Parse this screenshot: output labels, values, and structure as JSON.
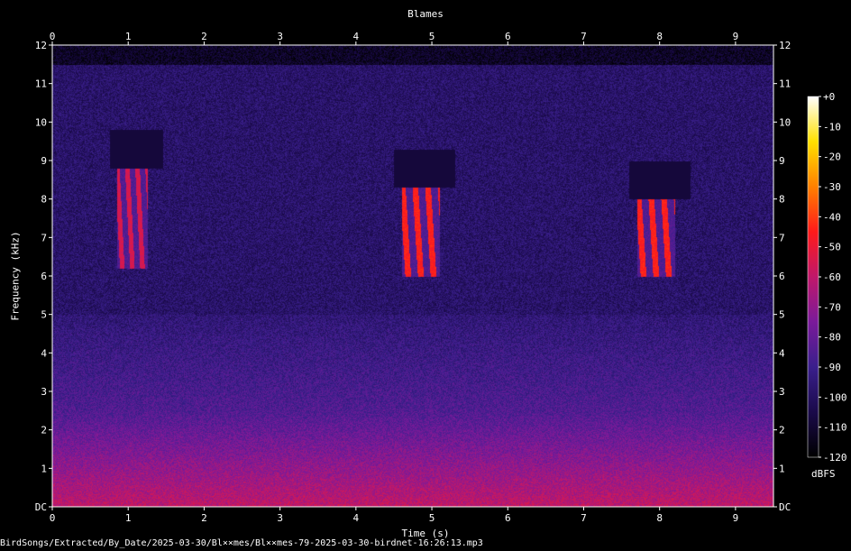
{
  "chart_data": {
    "type": "heatmap",
    "title": "Blames",
    "xlabel": "Time (s)",
    "ylabel": "Frequency (kHz)",
    "xlim": [
      0,
      9.5
    ],
    "ylim": [
      0,
      12
    ],
    "x_ticks": [
      "0",
      "1",
      "2",
      "3",
      "4",
      "5",
      "6",
      "7",
      "8",
      "9"
    ],
    "y_ticks": [
      "DC",
      "1",
      "2",
      "3",
      "4",
      "5",
      "6",
      "7",
      "8",
      "9",
      "10",
      "11",
      "12"
    ],
    "colorbar": {
      "label": "dBFS",
      "range": [
        -120,
        0
      ],
      "ticks": [
        "+0",
        "-10",
        "-20",
        "-30",
        "-40",
        "-50",
        "-60",
        "-70",
        "-80",
        "-90",
        "-100",
        "-110",
        "-120"
      ]
    },
    "colormap": [
      "#000000",
      "#1a0a4a",
      "#3a1f8c",
      "#7a1a9a",
      "#c0186a",
      "#ff1a1a",
      "#ff8000",
      "#ffe000",
      "#ffffff"
    ],
    "grid": false,
    "song_events": [
      {
        "start_s": 0.85,
        "end_s": 1.25,
        "low_khz": 6.2,
        "high_khz": 8.8,
        "level_dbfs": -55
      },
      {
        "start_s": 4.6,
        "end_s": 5.1,
        "low_khz": 6.0,
        "high_khz": 8.3,
        "level_dbfs": -45
      },
      {
        "start_s": 7.7,
        "end_s": 8.2,
        "low_khz": 6.0,
        "high_khz": 8.0,
        "level_dbfs": -45
      }
    ]
  },
  "footer": {
    "file_path": "BirdSongs/Extracted/By_Date/2025-03-30/Bl××mes/Bl××mes-79-2025-03-30-birdnet-16:26:13.mp3"
  }
}
